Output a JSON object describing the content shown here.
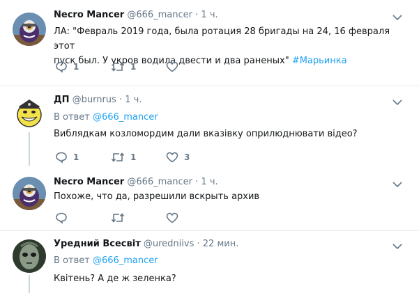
{
  "tweets": [
    {
      "name": "Necro Mancer",
      "handle": "@666_mancer",
      "dot": "·",
      "time": "1 ч.",
      "text_line1": "ЛА: \"Февраль 2019 года, была ротация 28 бригады на 24, 16 февраля этот",
      "text_line2": "пуск был. У укров водила двести и два раненых\"",
      "hashtag": "#Марьинка",
      "reply_count": "1",
      "retweet_count": "1",
      "like_count": ""
    },
    {
      "name": "ДП",
      "handle": "@burnrus",
      "dot": "·",
      "time": "1 ч.",
      "reply_prefix": "В ответ",
      "reply_handle": "@666_mancer",
      "text_line1": "Виблядкам козломордим дали вказівку оприлюднювати відео?",
      "reply_count": "1",
      "retweet_count": "1",
      "like_count": "3"
    },
    {
      "name": "Necro Mancer",
      "handle": "@666_mancer",
      "dot": "·",
      "time": "1 ч.",
      "text_line1": "Похоже, что да, разрешили вскрыть архив",
      "reply_count": "",
      "retweet_count": "",
      "like_count": ""
    },
    {
      "name": "Уредний Всесвіт",
      "handle": "@uredniivs",
      "dot": "·",
      "time": "22 мин.",
      "reply_prefix": "В ответ",
      "reply_handle": "@666_mancer",
      "text_line1": "Квітень? А де ж зеленка?"
    }
  ],
  "colors": {
    "accent": "#1da1f2",
    "muted": "#657786",
    "divider": "#e6ecf0"
  },
  "icons": [
    "reply-icon",
    "retweet-icon",
    "like-icon",
    "chevron-down-icon"
  ]
}
